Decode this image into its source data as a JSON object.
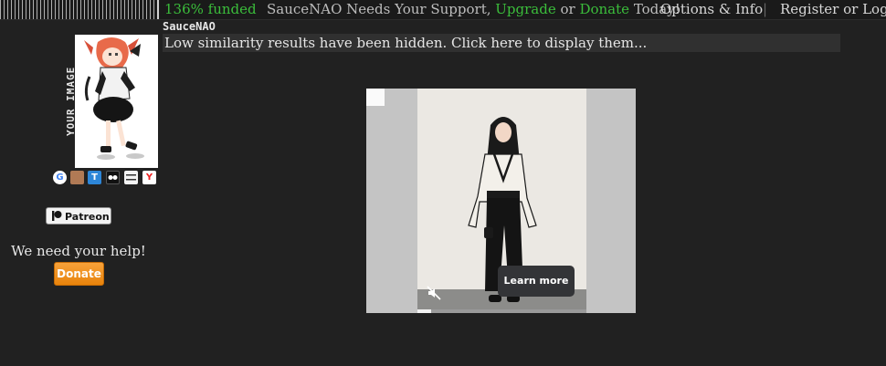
{
  "topbar": {
    "funded": "136% funded",
    "support_prefix": "SauceNAO Needs Your Support, ",
    "upgrade": "Upgrade",
    "or": " or ",
    "donate": "Donate",
    "support_suffix": " Today!",
    "options": "Options & Info",
    "separator": "|",
    "register": "Register or Login"
  },
  "sidebar": {
    "your_image_label": "YOUR IMAGE",
    "search_icons": [
      {
        "name": "google-icon",
        "glyph": "G"
      },
      {
        "name": "bing-icon",
        "glyph": ""
      },
      {
        "name": "tineye-icon",
        "glyph": "T"
      },
      {
        "name": "iqdb-icon",
        "glyph": ""
      },
      {
        "name": "imgops-icon",
        "glyph": ""
      },
      {
        "name": "yandex-icon",
        "glyph": "Y"
      }
    ],
    "patreon_label": "Patreon",
    "help_text": "We need your help!",
    "donate_label": "Donate"
  },
  "results": {
    "site_name": "SauceNAO",
    "hidden_notice": "Low similarity results have been hidden. Click here to display them..."
  },
  "ad": {
    "learn_more": "Learn more",
    "progress": 0.08
  },
  "colors": {
    "background": "#212121",
    "accent_green": "#3bbd3b",
    "donate_orange": "#f28a1a"
  }
}
